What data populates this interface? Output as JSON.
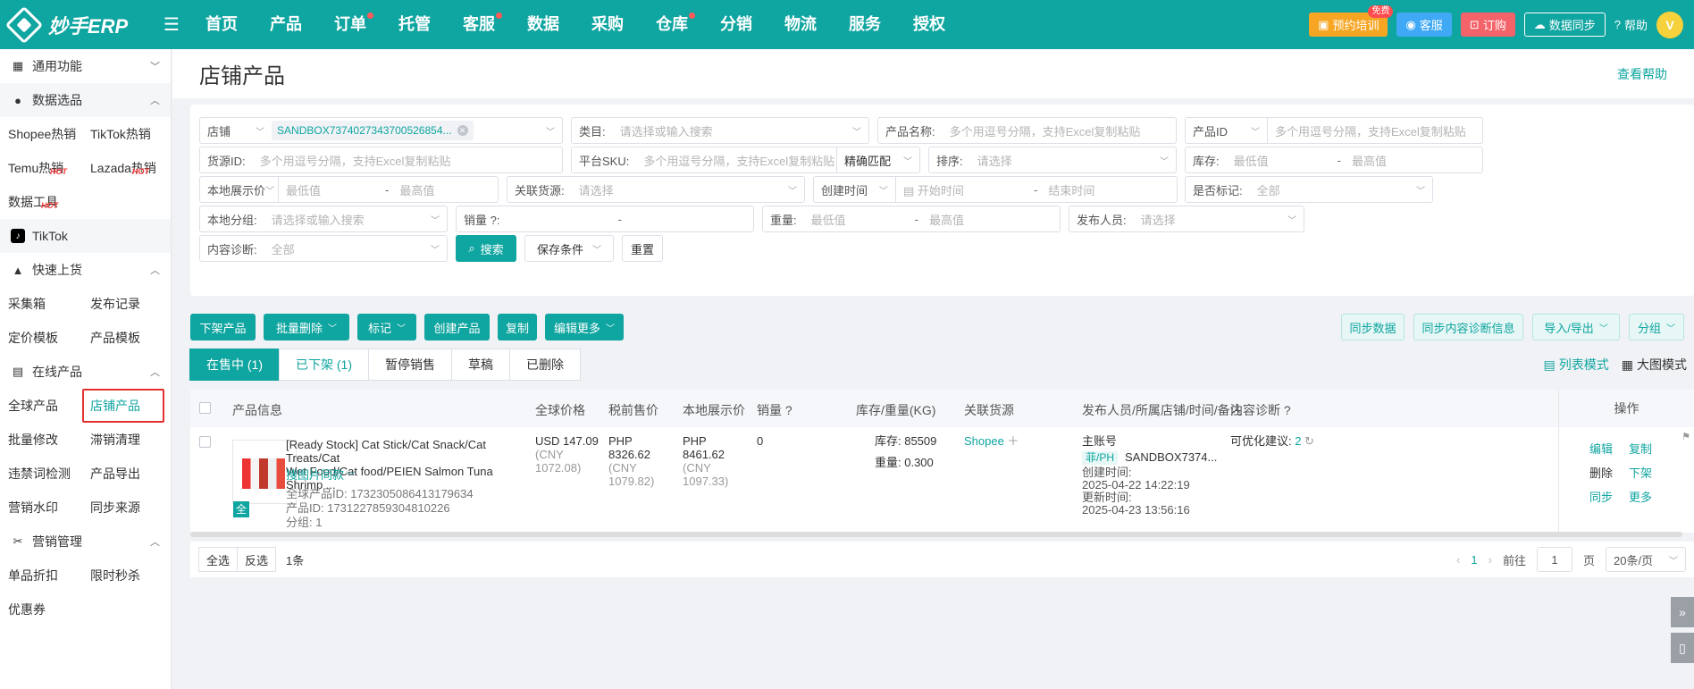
{
  "brand": {
    "name": "妙手ERP"
  },
  "nav": [
    {
      "label": "首页",
      "dot": false
    },
    {
      "label": "产品",
      "dot": false
    },
    {
      "label": "订单",
      "dot": true
    },
    {
      "label": "托管",
      "dot": false
    },
    {
      "label": "客服",
      "dot": true
    },
    {
      "label": "数据",
      "dot": false
    },
    {
      "label": "采购",
      "dot": false
    },
    {
      "label": "仓库",
      "dot": true
    },
    {
      "label": "分销",
      "dot": false
    },
    {
      "label": "物流",
      "dot": false
    },
    {
      "label": "服务",
      "dot": false
    },
    {
      "label": "授权",
      "dot": false
    }
  ],
  "topright": {
    "training": "预约培训",
    "training_badge": "免费",
    "service": "客服",
    "order": "订购",
    "sync": "数据同步",
    "help": "帮助",
    "avatar": "V"
  },
  "sidebar": {
    "general": "通用功能",
    "data_select": "数据选品",
    "data_items": [
      {
        "label": "Shopee热销",
        "hot": false
      },
      {
        "label": "TikTok热销",
        "hot": false
      },
      {
        "label": "Temu热销",
        "hot": true
      },
      {
        "label": "Lazada热销",
        "hot": true
      },
      {
        "label": "数据工具",
        "hot": true
      }
    ],
    "hot_label": "HOT",
    "tiktok": "TikTok",
    "quick_upload": "快速上货",
    "quick_items": [
      "采集箱",
      "发布记录",
      "定价模板",
      "产品模板"
    ],
    "online_products": "在线产品",
    "online_items": [
      "全球产品",
      "店铺产品",
      "批量修改",
      "滞销清理",
      "违禁词检测",
      "产品导出",
      "营销水印",
      "同步来源"
    ],
    "marketing": "营销管理",
    "marketing_items": [
      "单品折扣",
      "限时秒杀",
      "优惠券"
    ]
  },
  "page": {
    "title": "店铺产品",
    "help_link": "查看帮助"
  },
  "filters": {
    "shop_label": "店铺",
    "shop_tag": "SANDBOX7374027343700526854...",
    "category_label": "类目:",
    "category_ph": "请选择或输入搜索",
    "product_name_label": "产品名称:",
    "multi_ph": "多个用逗号分隔，支持Excel复制粘贴",
    "product_id_label": "产品ID",
    "source_id_label": "货源ID:",
    "platform_sku_label": "平台SKU:",
    "exact_match": "精确匹配",
    "sort_label": "排序:",
    "select_ph": "请选择",
    "stock_label": "库存:",
    "min_ph": "最低值",
    "max_ph": "最高值",
    "local_price_label": "本地展示价",
    "linked_source_label": "关联货源:",
    "create_time_label": "创建时间",
    "start_time_ph": "开始时间",
    "end_time_ph": "结束时间",
    "marked_label": "是否标记:",
    "all": "全部",
    "local_group_label": "本地分组:",
    "sales_label": "销量",
    "weight_label": "重量:",
    "publisher_label": "发布人员:",
    "content_diag_label": "内容诊断:",
    "search_btn": "搜索",
    "save_cond": "保存条件",
    "reset": "重置",
    "dash": "-"
  },
  "actions": {
    "delist": "下架产品",
    "batch_delete": "批量删除",
    "mark": "标记",
    "create": "创建产品",
    "copy": "复制",
    "edit_more": "编辑更多",
    "sync_data": "同步数据",
    "sync_diag": "同步内容诊断信息",
    "import_export": "导入/导出",
    "group": "分组"
  },
  "tabs": [
    {
      "label": "在售中 (1)",
      "state": "on"
    },
    {
      "label": "已下架 (1)",
      "state": "blue"
    },
    {
      "label": "暂停销售",
      "state": ""
    },
    {
      "label": "草稿",
      "state": ""
    },
    {
      "label": "已删除",
      "state": ""
    }
  ],
  "viewmodes": {
    "list": "列表模式",
    "grid": "大图模式"
  },
  "table": {
    "headers": {
      "info": "产品信息",
      "global_price": "全球价格",
      "pretax_price": "税前售价",
      "local_price": "本地展示价",
      "sales": "销量",
      "stock_weight": "库存/重量(KG)",
      "linked": "关联货源",
      "publisher": "发布人员/所属店铺/时间/备注",
      "diag": "内容诊断",
      "ops": "操作"
    },
    "row": {
      "title_line1": "[Ready Stock] Cat Stick/Cat Snack/Cat Treats/Cat",
      "title_line2": "Wet Food/Cat food/PEIEN Salmon Tuna Shrimp ...",
      "similar": "搜图片同款",
      "full_badge": "全",
      "global_id": "全球产品ID:  1732305086413179634",
      "product_id": "产品ID:  1731227859304810226",
      "group": "分组:  1",
      "global_price": "USD 147.09",
      "global_price_cny1": "(CNY",
      "global_price_cny2": "1072.08)",
      "pretax1": "PHP",
      "pretax2": "8326.62",
      "pretax3": "(CNY",
      "pretax4": "1079.82)",
      "local1": "PHP",
      "local2": "8461.62",
      "local3": "(CNY",
      "local4": "1097.33)",
      "sales": "0",
      "stock": "库存:  85509",
      "weight": "重量:  0.300",
      "linked": "Shopee",
      "publisher": "主账号",
      "region": "菲/PH",
      "shop": "SANDBOX7374...",
      "created_label": "创建时间:",
      "created": "2025-04-22 14:22:19",
      "updated_label": "更新时间:",
      "updated": "2025-04-23 13:56:16",
      "diag": "可优化建议:",
      "diag_count": "2",
      "ops": {
        "edit": "编辑",
        "copy": "复制",
        "delete": "删除",
        "delist": "下架",
        "sync": "同步",
        "more": "更多"
      }
    }
  },
  "footer": {
    "select_all": "全选",
    "invert": "反选",
    "count": "1条",
    "page": "1",
    "goto": "前往",
    "goto_page": "1",
    "page_unit": "页",
    "per_page": "20条/页"
  }
}
